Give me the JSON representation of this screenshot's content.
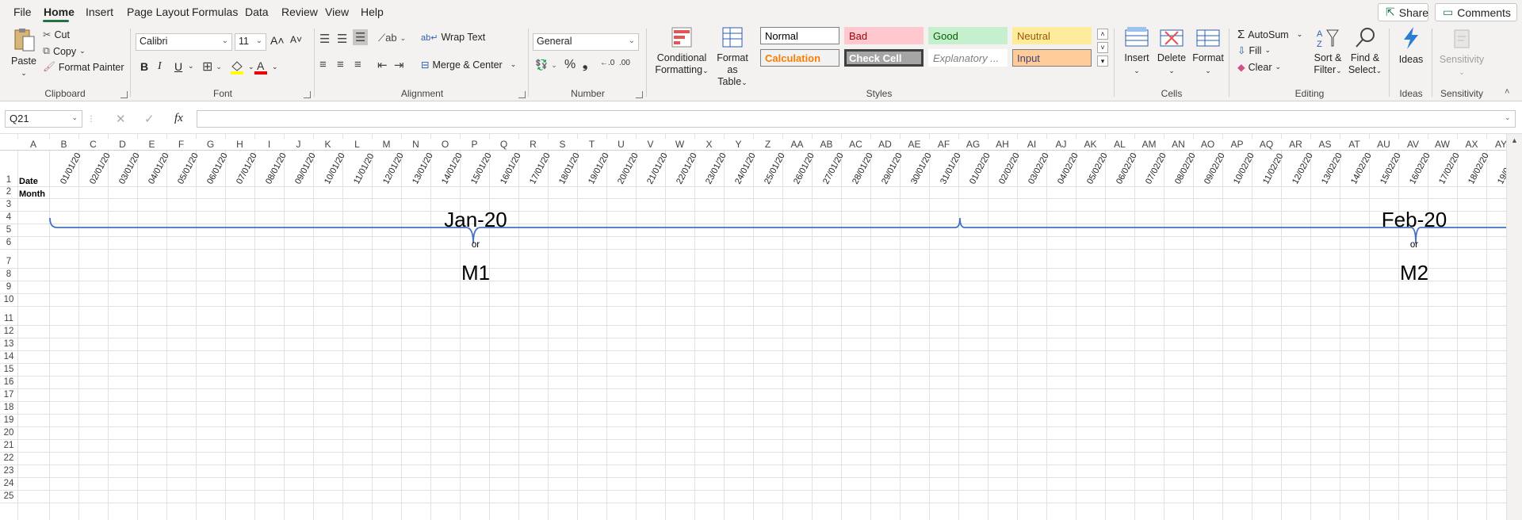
{
  "menu": {
    "tabs": [
      "File",
      "Home",
      "Insert",
      "Page Layout",
      "Formulas",
      "Data",
      "Review",
      "View",
      "Help"
    ],
    "active": "Home",
    "share": "Share",
    "comments": "Comments"
  },
  "ribbon": {
    "clipboard": {
      "label": "Clipboard",
      "paste": "Paste",
      "cut": "Cut",
      "copy": "Copy",
      "format_painter": "Format Painter"
    },
    "font": {
      "label": "Font",
      "family": "Calibri",
      "size": "11",
      "bold": "B",
      "italic": "I",
      "underline": "U"
    },
    "alignment": {
      "label": "Alignment",
      "wrap_text": "Wrap Text",
      "merge_center": "Merge & Center"
    },
    "number": {
      "label": "Number",
      "format": "General"
    },
    "styles": {
      "label": "Styles",
      "conditional": [
        "Conditional",
        "Formatting"
      ],
      "format_table": [
        "Format as",
        "Table"
      ],
      "cells": [
        {
          "name": "Normal",
          "bg": "#ffffff",
          "color": "#000000",
          "border": "#7f7f7f"
        },
        {
          "name": "Bad",
          "bg": "#ffc7ce",
          "color": "#9c0006",
          "border": "#ffc7ce"
        },
        {
          "name": "Good",
          "bg": "#c6efce",
          "color": "#006100",
          "border": "#c6efce"
        },
        {
          "name": "Neutral",
          "bg": "#ffeb9c",
          "color": "#9c5700",
          "border": "#ffeb9c"
        },
        {
          "name": "Calculation",
          "bg": "#f2f2f2",
          "color": "#fa7d00",
          "border": "#7f7f7f"
        },
        {
          "name": "Check Cell",
          "bg": "#a5a5a5",
          "color": "#ffffff",
          "border": "#3f3f3f"
        },
        {
          "name": "Explanatory ...",
          "bg": "#ffffff",
          "color": "#7f7f7f",
          "border": "#ffffff"
        },
        {
          "name": "Input",
          "bg": "#ffcc99",
          "color": "#3f3f76",
          "border": "#7f7f7f"
        }
      ]
    },
    "cells": {
      "label": "Cells",
      "insert": "Insert",
      "delete": "Delete",
      "format": "Format"
    },
    "editing": {
      "label": "Editing",
      "autosum": "AutoSum",
      "fill": "Fill",
      "clear": "Clear",
      "sort_filter": [
        "Sort &",
        "Filter"
      ],
      "find_select": [
        "Find &",
        "Select"
      ]
    },
    "ideas": {
      "label": "Ideas",
      "button": "Ideas"
    },
    "sensitivity": {
      "label": "Sensitivity",
      "button": "Sensitivity"
    }
  },
  "formula_bar": {
    "name_box": "Q21",
    "fx": "fx",
    "content": ""
  },
  "columns": [
    "A",
    "B",
    "C",
    "D",
    "E",
    "F",
    "G",
    "H",
    "I",
    "J",
    "K",
    "L",
    "M",
    "N",
    "O",
    "P",
    "Q",
    "R",
    "S",
    "T",
    "U",
    "V",
    "W",
    "X",
    "Y",
    "Z",
    "AA",
    "AB",
    "AC",
    "AD",
    "AE",
    "AF",
    "AG",
    "AH",
    "AI",
    "AJ",
    "AK",
    "AL",
    "AM",
    "AN",
    "AO",
    "AP",
    "AQ",
    "AR",
    "AS",
    "AT",
    "AU",
    "AV",
    "AW",
    "AX",
    "AY"
  ],
  "dates": [
    "01/01/20",
    "02/01/20",
    "03/01/20",
    "04/01/20",
    "05/01/20",
    "06/01/20",
    "07/01/20",
    "08/01/20",
    "09/01/20",
    "10/01/20",
    "11/01/20",
    "12/01/20",
    "13/01/20",
    "14/01/20",
    "15/01/20",
    "16/01/20",
    "17/01/20",
    "18/01/20",
    "19/01/20",
    "20/01/20",
    "21/01/20",
    "22/01/20",
    "23/01/20",
    "24/01/20",
    "25/01/20",
    "26/01/20",
    "27/01/20",
    "28/01/20",
    "29/01/20",
    "30/01/20",
    "31/01/20",
    "01/02/20",
    "02/02/20",
    "03/02/20",
    "04/02/20",
    "05/02/20",
    "06/02/20",
    "07/02/20",
    "08/02/20",
    "09/02/20",
    "10/02/20",
    "11/02/20",
    "12/02/20",
    "13/02/20",
    "14/02/20",
    "15/02/20",
    "16/02/20",
    "17/02/20",
    "18/02/20",
    "19/0"
  ],
  "rows": [
    "1",
    "2",
    "3",
    "4",
    "5",
    "6",
    "7",
    "8",
    "9",
    "10",
    "11",
    "12",
    "13",
    "14",
    "15",
    "16",
    "17",
    "18",
    "19",
    "20",
    "21",
    "22",
    "23",
    "24",
    "25"
  ],
  "cells": {
    "a1": "Date",
    "a2": "Month"
  },
  "annotations": {
    "jan": "Jan-20",
    "feb": "Feb-20",
    "or": "or",
    "m1": "M1",
    "m2": "M2"
  }
}
